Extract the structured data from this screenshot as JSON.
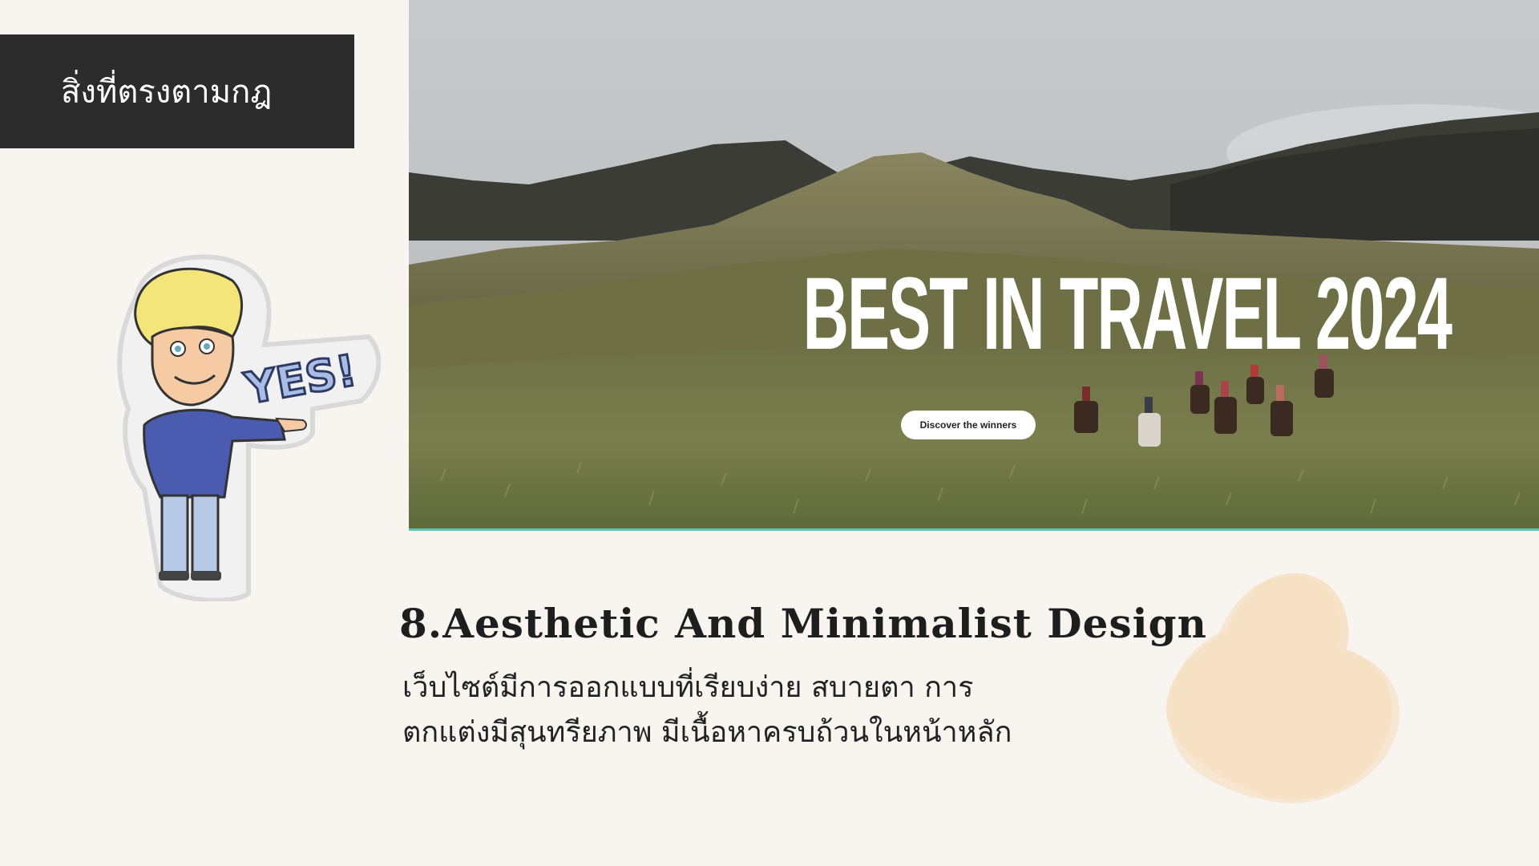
{
  "header": {
    "title": "สิ่งที่ตรงตามกฎ"
  },
  "hero": {
    "headline": "BEST IN TRAVEL 2024",
    "cta_label": "Discover the winners"
  },
  "cartoon": {
    "speech": "YES!"
  },
  "section": {
    "title": "8.Aesthetic And Minimalist Design",
    "body_lines": [
      "เว็บไซต์มีการออกแบบที่เรียบง่าย สบายตา การ",
      "ตกแต่งมีสุนทรียภาพ มีเนื้อหาครบถ้วนในหน้าหลัก"
    ]
  },
  "colors": {
    "background": "#f8f5f1",
    "header_box": "#2c2c2c",
    "blob": "#f7dfc2",
    "hero_underline": "#5bc7b5"
  }
}
